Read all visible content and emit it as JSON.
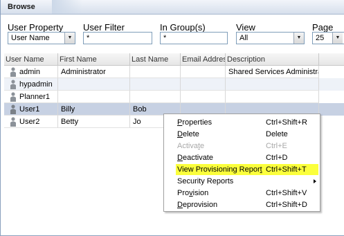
{
  "panel": {
    "title": "Browse"
  },
  "filters": {
    "user_property": {
      "label": "User Property",
      "value": "User Name"
    },
    "user_filter": {
      "label": "User Filter",
      "value": "*"
    },
    "in_group": {
      "label": "In Group(s)",
      "value": "*"
    },
    "view": {
      "label": "View",
      "value": "All"
    },
    "page_size": {
      "label": "Page Siz",
      "value": "25"
    }
  },
  "table": {
    "columns": [
      "User Name",
      "First Name",
      "Last Name",
      "Email Addres",
      "Description"
    ],
    "rows": [
      {
        "user": "admin",
        "first": "Administrator",
        "last": "",
        "email": "",
        "description": "Shared Services Administra"
      },
      {
        "user": "hypadmin",
        "first": "",
        "last": "",
        "email": "",
        "description": ""
      },
      {
        "user": "Planner1",
        "first": "",
        "last": "",
        "email": "",
        "description": ""
      },
      {
        "user": "User1",
        "first": "Billy",
        "last": "Bob",
        "email": "",
        "description": ""
      },
      {
        "user": "User2",
        "first": "Betty",
        "last": "Jo",
        "email": "",
        "description": ""
      }
    ]
  },
  "context_menu": {
    "items": [
      {
        "label": "Properties",
        "shortcut": "Ctrl+Shift+R",
        "enabled": true
      },
      {
        "label": "Delete",
        "shortcut": "Delete",
        "enabled": true
      },
      {
        "label": "Activate",
        "shortcut": "Ctrl+E",
        "enabled": false
      },
      {
        "label": "Deactivate",
        "shortcut": "Ctrl+D",
        "enabled": true
      },
      {
        "label": "View Provisioning Report",
        "shortcut": "Ctrl+Shift+T",
        "enabled": true,
        "highlighted": true
      },
      {
        "label": "Security Reports",
        "shortcut": "",
        "enabled": true,
        "submenu": true
      },
      {
        "label": "Provision",
        "shortcut": "Ctrl+Shift+V",
        "enabled": true
      },
      {
        "label": "Deprovision",
        "shortcut": "Ctrl+Shift+D",
        "enabled": true
      }
    ]
  },
  "colors": {
    "highlight": "#fbff3c",
    "selected_row": "#c7d1e3",
    "alt_row": "#eef2f8"
  },
  "icons": {
    "user": "user-icon",
    "dropdown": "chevron-down-icon",
    "submenu": "chevron-right-icon"
  }
}
